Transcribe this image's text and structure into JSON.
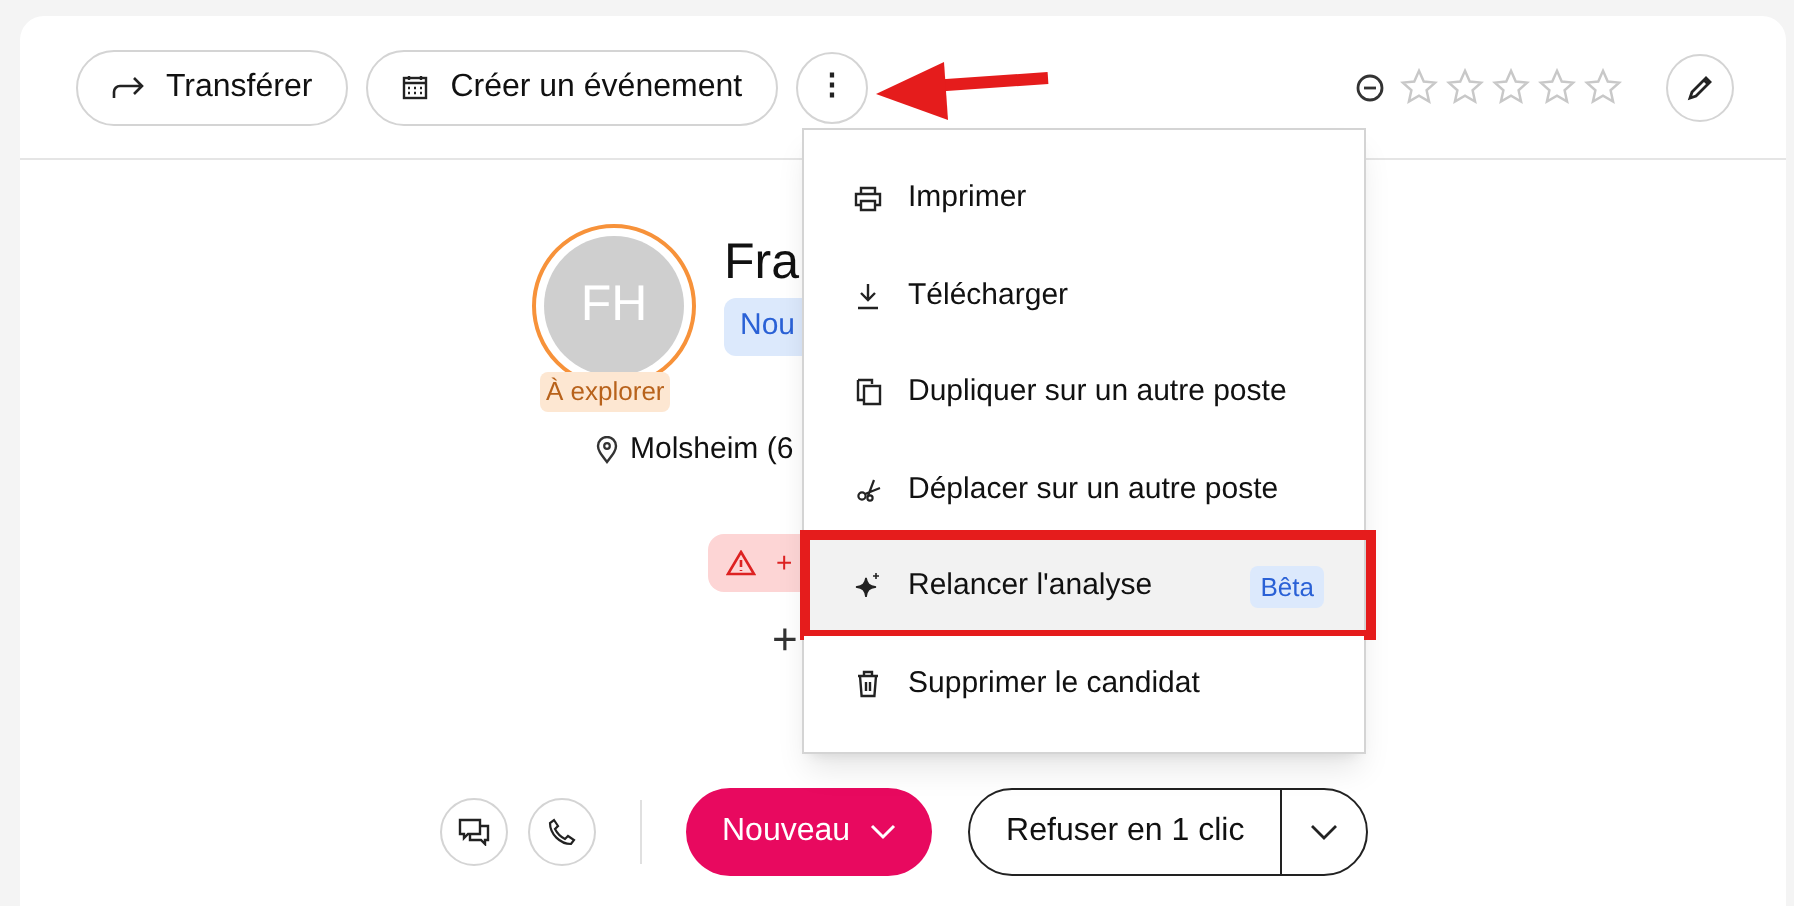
{
  "toolbar": {
    "buttons": [
      {
        "label": "Transférer"
      },
      {
        "label": "Créer un événement"
      }
    ],
    "more_button": {
      "label": "⋮"
    },
    "rating": {
      "stars": 0
    }
  },
  "profile": {
    "initials": "FH",
    "status_badge": "À explorer",
    "name": "Fra",
    "stage_badge": "Nou",
    "location": "Molsheim (6",
    "alert_badge": "+",
    "add_label": "+"
  },
  "menu": {
    "items": [
      {
        "label": "Imprimer",
        "highlighted": false
      },
      {
        "label": "Télécharger",
        "highlighted": false
      },
      {
        "label": "Dupliquer sur un autre poste",
        "highlighted": false
      },
      {
        "label": "Déplacer sur un autre poste",
        "highlighted": false
      },
      {
        "label": "Relancer l'analyse",
        "badge": "Bêta",
        "highlighted": true
      },
      {
        "label": "Supprimer le candidat",
        "highlighted": false
      }
    ]
  },
  "actions": {
    "stage_button": "Nouveau",
    "reject_button": "Refuser en 1 clic"
  }
}
